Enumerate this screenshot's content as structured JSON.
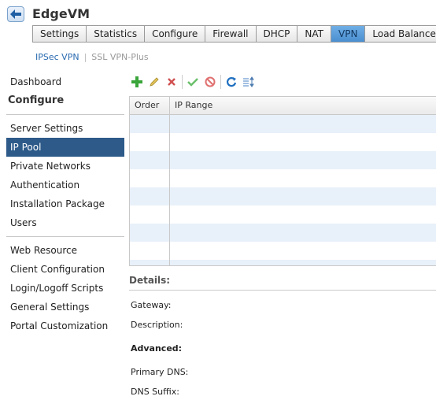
{
  "header": {
    "title": "EdgeVM"
  },
  "tabs": [
    {
      "label": "Settings"
    },
    {
      "label": "Statistics"
    },
    {
      "label": "Configure"
    },
    {
      "label": "Firewall"
    },
    {
      "label": "DHCP"
    },
    {
      "label": "NAT"
    },
    {
      "label": "VPN"
    },
    {
      "label": "Load Balancer"
    }
  ],
  "active_tab": "VPN",
  "subtabs": {
    "active": "IPSec VPN",
    "other": "SSL VPN-Plus",
    "separator": "|"
  },
  "sidebar": {
    "dashboard": "Dashboard",
    "heading": "Configure",
    "group1": [
      "Server Settings",
      "IP Pool",
      "Private Networks",
      "Authentication",
      "Installation Package",
      "Users"
    ],
    "selected": "IP Pool",
    "group2": [
      "Web Resource",
      "Client Configuration",
      "Login/Logoff Scripts",
      "General Settings",
      "Portal Customization"
    ]
  },
  "toolbar": {
    "icons": [
      "add-icon",
      "edit-icon",
      "delete-icon",
      "enable-icon",
      "disable-icon",
      "refresh-icon",
      "reorder-icon"
    ]
  },
  "grid": {
    "columns": [
      "Order",
      "IP Range"
    ],
    "rows": []
  },
  "details": {
    "label": "Details:",
    "gateway_label": "Gateway:",
    "description_label": "Description:",
    "advanced_label": "Advanced:",
    "primary_dns_label": "Primary DNS:",
    "dns_suffix_label": "DNS Suffix:"
  },
  "colors": {
    "selected_nav_bg": "#2d5a89",
    "active_tab_bg": "#5a9bd8",
    "row_alt": "#e8f0f9",
    "link": "#2a6bb0"
  }
}
